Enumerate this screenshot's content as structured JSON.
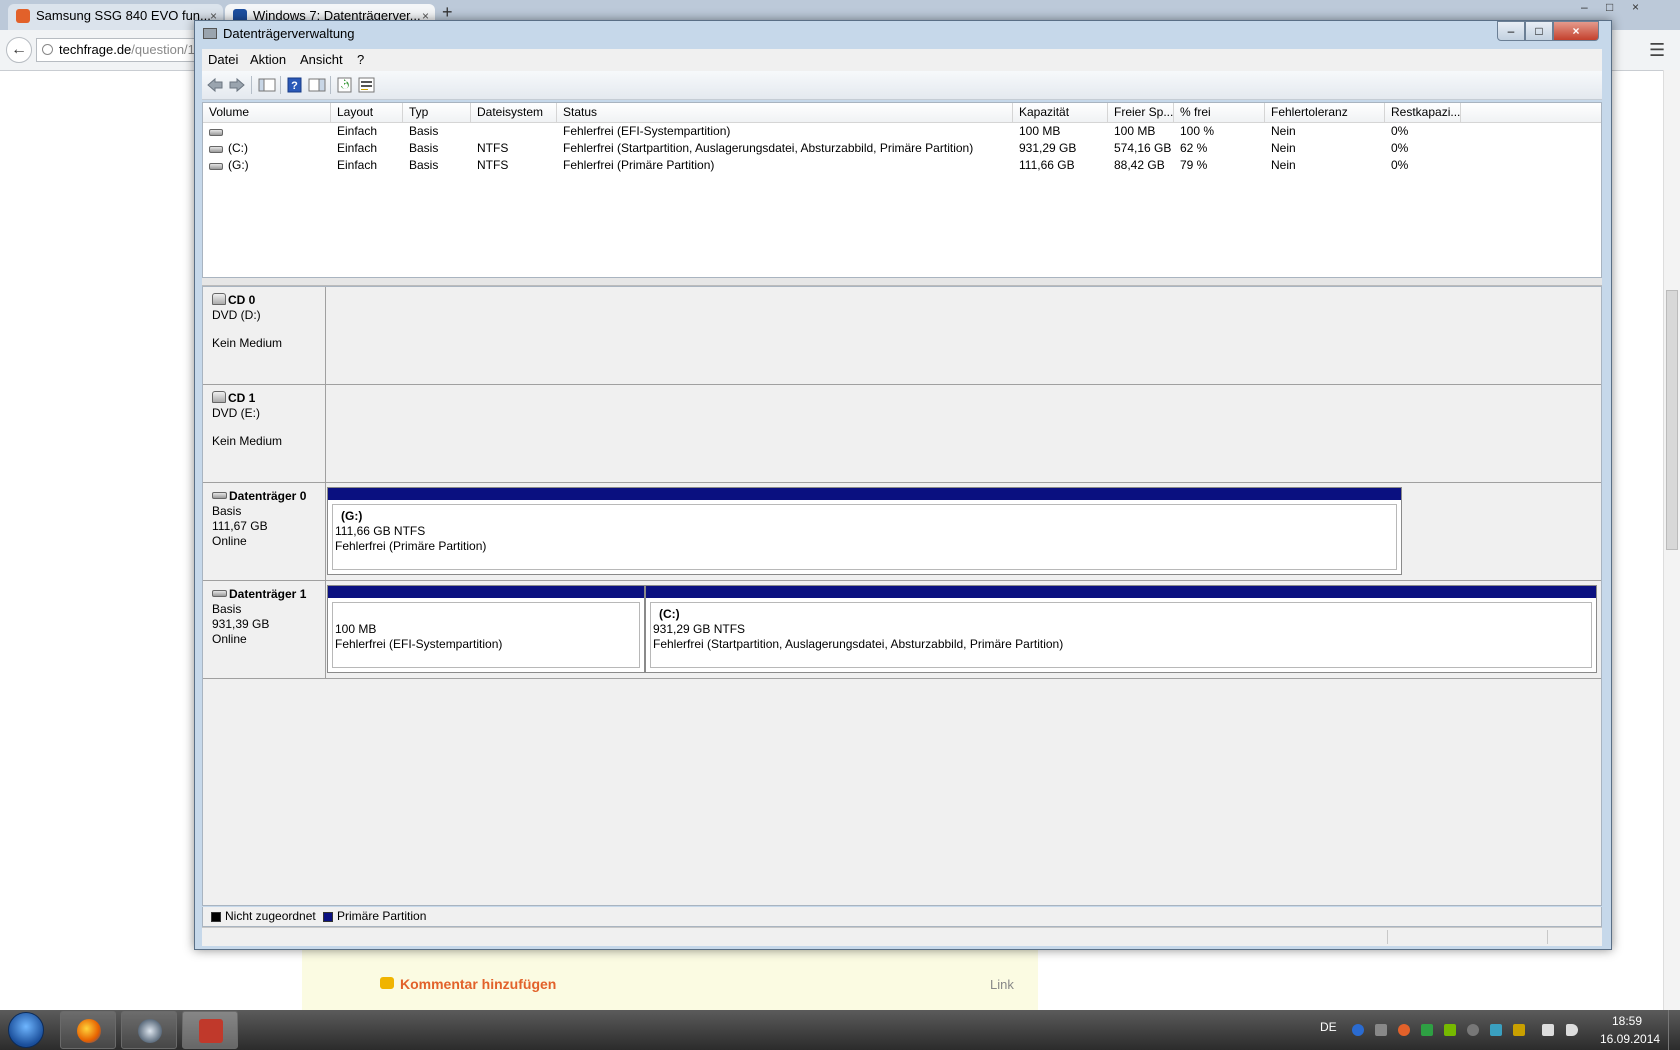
{
  "browser": {
    "tabs": [
      {
        "label": "Samsung SSG 840 EVO fun...",
        "close": "×"
      },
      {
        "label": "Windows 7: Datenträgerver...",
        "close": "×"
      }
    ],
    "new_tab": "+",
    "back": "←",
    "url_host": "techfrage.de",
    "url_path": "/question/17",
    "menu_icon": "hamburger-icon",
    "window_controls": {
      "min": "–",
      "max": "□",
      "close": "×"
    },
    "page": {
      "comment_link": "Kommentar hinzufügen",
      "link_label": "Link"
    }
  },
  "dm": {
    "title": "Datenträgerverwaltung",
    "controls": {
      "min": "–",
      "max": "□",
      "close": "×"
    },
    "menu": [
      "Datei",
      "Aktion",
      "Ansicht",
      "?"
    ],
    "toolbar_icons": [
      "back-arrow-icon",
      "forward-arrow-icon",
      "console-tree-icon",
      "help-icon",
      "properties-icon",
      "refresh-icon",
      "settings-icon"
    ],
    "columns": [
      "Volume",
      "Layout",
      "Typ",
      "Dateisystem",
      "Status",
      "Kapazität",
      "Freier Sp...",
      "% frei",
      "Fehlertoleranz",
      "Restkapazi..."
    ],
    "volumes": [
      {
        "volume": "",
        "layout": "Einfach",
        "typ": "Basis",
        "fs": "",
        "status": "Fehlerfrei (EFI-Systempartition)",
        "kapazitaet": "100 MB",
        "frei": "100 MB",
        "prozent": "100 %",
        "fehlertoleranz": "Nein",
        "rest": "0%"
      },
      {
        "volume": "(C:)",
        "layout": "Einfach",
        "typ": "Basis",
        "fs": "NTFS",
        "status": "Fehlerfrei (Startpartition, Auslagerungsdatei, Absturzabbild, Primäre Partition)",
        "kapazitaet": "931,29 GB",
        "frei": "574,16 GB",
        "prozent": "62 %",
        "fehlertoleranz": "Nein",
        "rest": "0%"
      },
      {
        "volume": "(G:)",
        "layout": "Einfach",
        "typ": "Basis",
        "fs": "NTFS",
        "status": "Fehlerfrei (Primäre Partition)",
        "kapazitaet": "111,66 GB",
        "frei": "88,42 GB",
        "prozent": "79 %",
        "fehlertoleranz": "Nein",
        "rest": "0%"
      }
    ],
    "disks": [
      {
        "name": "CD 0",
        "line1": "DVD (D:)",
        "line2": "",
        "line3": "Kein Medium"
      },
      {
        "name": "CD 1",
        "line1": "DVD (E:)",
        "line2": "",
        "line3": "Kein Medium"
      },
      {
        "name": "Datenträger 0",
        "line1": "Basis",
        "line2": "111,67 GB",
        "line3": "Online"
      },
      {
        "name": "Datenträger 1",
        "line1": "Basis",
        "line2": "931,39 GB",
        "line3": "Online"
      }
    ],
    "partitions": {
      "g": {
        "name": "(G:)",
        "size": "111,66 GB NTFS",
        "status": "Fehlerfrei (Primäre Partition)"
      },
      "efi": {
        "name": "",
        "size": "100 MB",
        "status": "Fehlerfrei (EFI-Systempartition)"
      },
      "c": {
        "name": "(C:)",
        "size": "931,29 GB NTFS",
        "status": "Fehlerfrei (Startpartition, Auslagerungsdatei, Absturzabbild, Primäre Partition)"
      }
    },
    "legend": [
      {
        "label": "Nicht zugeordnet",
        "color": "#000000"
      },
      {
        "label": "Primäre Partition",
        "color": "#0a1080"
      }
    ]
  },
  "taskbar": {
    "apps": [
      "firefox-icon",
      "media-player-icon",
      "disk-management-icon"
    ],
    "language": "DE",
    "time": "18:59",
    "date": "16.09.2014"
  }
}
